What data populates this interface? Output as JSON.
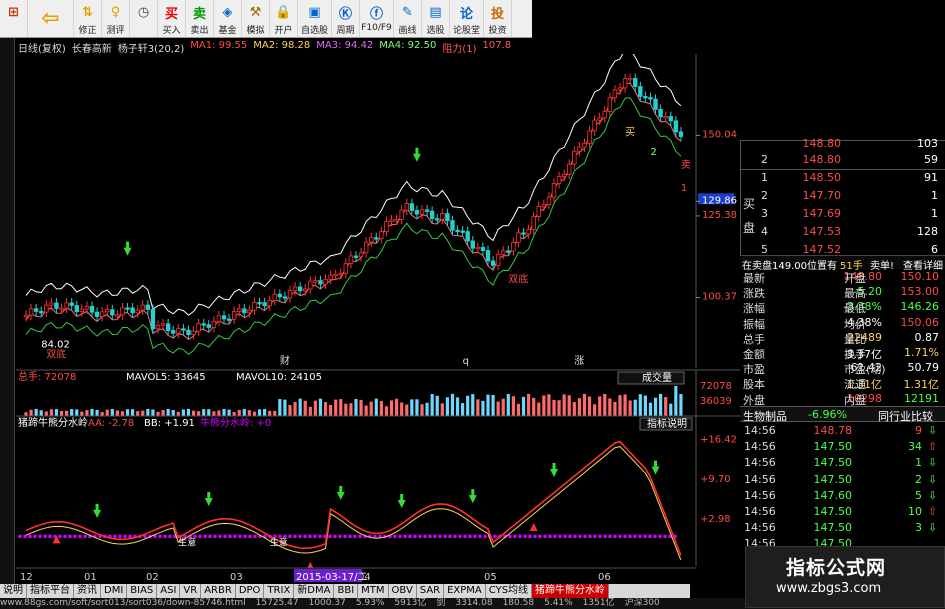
{
  "toolbar": [
    {
      "icon": "add-window-icon",
      "glyph": "⊞",
      "label": "",
      "color": "#c30"
    },
    {
      "icon": "back-arrow-icon",
      "glyph": "⇦",
      "label": "",
      "color": "#e8a000",
      "big": true
    },
    {
      "icon": "rights-adjust-icon",
      "glyph": "⇅",
      "label": "修正",
      "color": "#e8a000"
    },
    {
      "icon": "test-icon",
      "glyph": "♀",
      "label": "测评",
      "color": "#e8a000"
    },
    {
      "icon": "stopwatch-icon",
      "glyph": "◷",
      "label": "",
      "color": "#444"
    },
    {
      "icon": "buy-icon",
      "glyph": "买",
      "label": "买入",
      "color": "#e00"
    },
    {
      "icon": "sell-icon",
      "glyph": "卖",
      "label": "卖出",
      "color": "#090"
    },
    {
      "icon": "fund-icon",
      "glyph": "◈",
      "label": "基金",
      "color": "#06c"
    },
    {
      "icon": "hammer-icon",
      "glyph": "⚒",
      "label": "模拟",
      "color": "#a60"
    },
    {
      "icon": "lock-icon",
      "glyph": "🔒",
      "label": "开户",
      "color": "#555"
    },
    {
      "icon": "watchlist-icon",
      "glyph": "▣",
      "label": "自选股",
      "color": "#06c"
    },
    {
      "icon": "period-icon",
      "glyph": "Ⓚ",
      "label": "周期",
      "color": "#06c"
    },
    {
      "icon": "f10-icon",
      "glyph": "ⓕ",
      "label": "F10/F9",
      "color": "#06c"
    },
    {
      "icon": "pen-icon",
      "glyph": "✎",
      "label": "画线",
      "color": "#06c"
    },
    {
      "icon": "stock-pick-icon",
      "glyph": "▤",
      "label": "选股",
      "color": "#06c"
    },
    {
      "icon": "forum-icon",
      "glyph": "论",
      "label": "论股堂",
      "color": "#06c"
    },
    {
      "icon": "investor-icon",
      "glyph": "投",
      "label": "投资",
      "color": "#c60"
    }
  ],
  "header": {
    "mode": "日线(复权)",
    "stock": "长春高新",
    "indicator": "杨子轩3(20,2)",
    "ma1": "MA1: 99.55",
    "ma2": "MA2: 98.28",
    "ma3": "MA3: 94.42",
    "ma4": "MA4: 92.50",
    "power": "阻力(1)",
    "tail": "107.8"
  },
  "price_axis": {
    "labels": [
      {
        "text": "150.04",
        "value": 150.04
      },
      {
        "text": "129.86",
        "value": 129.86,
        "highlight": true
      },
      {
        "text": "125.38",
        "value": 125.38
      },
      {
        "text": "100.37",
        "value": 100.37
      }
    ],
    "min": 80,
    "max": 175
  },
  "chart_notes": {
    "buy_marker": "买",
    "sell_marker": "卖",
    "digit2": "2",
    "digit1": "1",
    "low1": "84.02",
    "low2": "双底",
    "low3": "双底",
    "mark_a": "财",
    "mark_b": "q",
    "mark_c": "涨"
  },
  "volume": {
    "label": "总手: 72078",
    "mavol5": "MAVOL5: 33645",
    "mavol10": "MAVOL10: 24105",
    "button": "成交量",
    "axis": [
      {
        "text": "72078",
        "value": 72078
      },
      {
        "text": "36039",
        "value": 36039
      }
    ]
  },
  "osc": {
    "name": "猪蹄牛熊分水岭",
    "aa": "AA: -2.78",
    "bb": "BB: +1.91",
    "line": "牛熊分水岭: +0",
    "button": "指标说明",
    "axis": [
      {
        "text": "+16.42",
        "value": 16.42
      },
      {
        "text": "+9.70",
        "value": 9.7
      },
      {
        "text": "+2.98",
        "value": 2.98
      }
    ],
    "notes": [
      "生意",
      "生意"
    ],
    "min": -5,
    "max": 18
  },
  "date_axis": [
    "12",
    "01",
    "02",
    "03",
    "04",
    "05",
    "06"
  ],
  "date_highlight": "2015-03-17/二",
  "orderbook": {
    "rows": [
      {
        "lvl": "",
        "px": "148.80",
        "vol": "103",
        "side": "sell"
      },
      {
        "lvl": "2",
        "px": "148.80",
        "vol": "59",
        "side": "sell"
      },
      {
        "lvl": "1",
        "px": "148.50",
        "vol": "91",
        "side": "buy"
      },
      {
        "lvl": "2",
        "px": "147.70",
        "vol": "1",
        "side": "buy"
      },
      {
        "lvl": "3",
        "px": "147.69",
        "vol": "1",
        "side": "buy"
      },
      {
        "lvl": "4",
        "px": "147.53",
        "vol": "128",
        "side": "buy"
      },
      {
        "lvl": "5",
        "px": "147.52",
        "vol": "6",
        "side": "buy"
      }
    ],
    "side_label": "买盘"
  },
  "weidian": {
    "text": "在卖盘149.00位置有",
    "lots": "51手",
    "action": "卖单!",
    "detail": "查看详细"
  },
  "quote": [
    {
      "l1": "最新",
      "v1": "148.80",
      "c1": "#ff4a4a",
      "l2": "开盘",
      "v2": "150.10",
      "c2": "#ff4a4a"
    },
    {
      "l1": "涨跌",
      "v1": "-5.20",
      "c1": "#4aff4a",
      "l2": "最高",
      "v2": "153.00",
      "c2": "#ff4a4a"
    },
    {
      "l1": "涨幅",
      "v1": "-3.38%",
      "c1": "#4aff4a",
      "l2": "最低",
      "v2": "146.26",
      "c2": "#4aff4a"
    },
    {
      "l1": "振幅",
      "v1": "4.38%",
      "c1": "#fff",
      "l2": "均价",
      "v2": "150.06",
      "c2": "#ff4a4a"
    },
    {
      "l1": "总手",
      "v1": "22489",
      "c1": "#ffd35c",
      "l2": "量比",
      "v2": "0.87",
      "c2": "#fff"
    },
    {
      "l1": "金额",
      "v1": "3.37亿",
      "c1": "#fff",
      "l2": "换手",
      "v2": "1.71%",
      "c2": "#ffd35c"
    },
    {
      "l1": "市盈",
      "v1": "61.42",
      "c1": "#fff",
      "l2": "市盈(动)",
      "v2": "50.79",
      "c2": "#fff"
    },
    {
      "l1": "股本",
      "v1": "1.31亿",
      "c1": "#ffd35c",
      "l2": "流通",
      "v2": "1.31亿",
      "c2": "#ffd35c"
    },
    {
      "l1": "外盘",
      "v1": "10298",
      "c1": "#ff4a4a",
      "l2": "内盘",
      "v2": "12191",
      "c2": "#4aff4a"
    }
  ],
  "sector": {
    "name": "生物制品",
    "pct": "-6.96%",
    "compare": "同行业比较"
  },
  "ticks": [
    {
      "t": "14:56",
      "p": "148.78",
      "v": "9",
      "a": "⇩",
      "c": "#ff4a4a"
    },
    {
      "t": "14:56",
      "p": "147.50",
      "v": "34",
      "a": "⇧",
      "c": "#4aff4a"
    },
    {
      "t": "14:56",
      "p": "147.50",
      "v": "1",
      "a": "⇩",
      "c": "#4aff4a"
    },
    {
      "t": "14:56",
      "p": "147.50",
      "v": "2",
      "a": "⇩",
      "c": "#4aff4a"
    },
    {
      "t": "14:56",
      "p": "147.60",
      "v": "5",
      "a": "⇩",
      "c": "#4aff4a"
    },
    {
      "t": "14:56",
      "p": "147.50",
      "v": "10",
      "a": "⇧",
      "c": "#4aff4a"
    },
    {
      "t": "14:56",
      "p": "147.50",
      "v": "3",
      "a": "⇩",
      "c": "#4aff4a"
    },
    {
      "t": "14:56",
      "p": "147.50",
      "v": "",
      "a": "",
      "c": "#4aff4a"
    }
  ],
  "tabs": [
    "说明",
    "指标平台",
    "资讯",
    "DMI",
    "BIAS",
    "ASI",
    "VR",
    "ARBR",
    "DPO",
    "TRIX",
    "新DMA",
    "BBI",
    "MTM",
    "OBV",
    "SAR",
    "EXPMA",
    "CYS均线",
    "猪蹄牛熊分水岭"
  ],
  "status": [
    "www.88gs.com/soft/sort013/sort036/down-85746.html",
    "15725.47",
    "1000.37",
    "5.93%",
    "5913亿",
    "剑",
    "3314.08",
    "180.58",
    "5.41%",
    "1351亿",
    "沪深300"
  ],
  "watermark": {
    "line1": "指标公式网",
    "line2": "www.zbgs3.com"
  },
  "colors": {
    "up": "#ff4a4a",
    "down": "#4aff4a",
    "ma_line": "#ff6b6b",
    "upper_band": "#ffffff",
    "lower_band": "#2ecc40",
    "candle_up": "#ff3030",
    "candle_down": "#22d0d0",
    "buy_arrow": "#33dd33",
    "osc_dot": "#d000ff"
  }
}
